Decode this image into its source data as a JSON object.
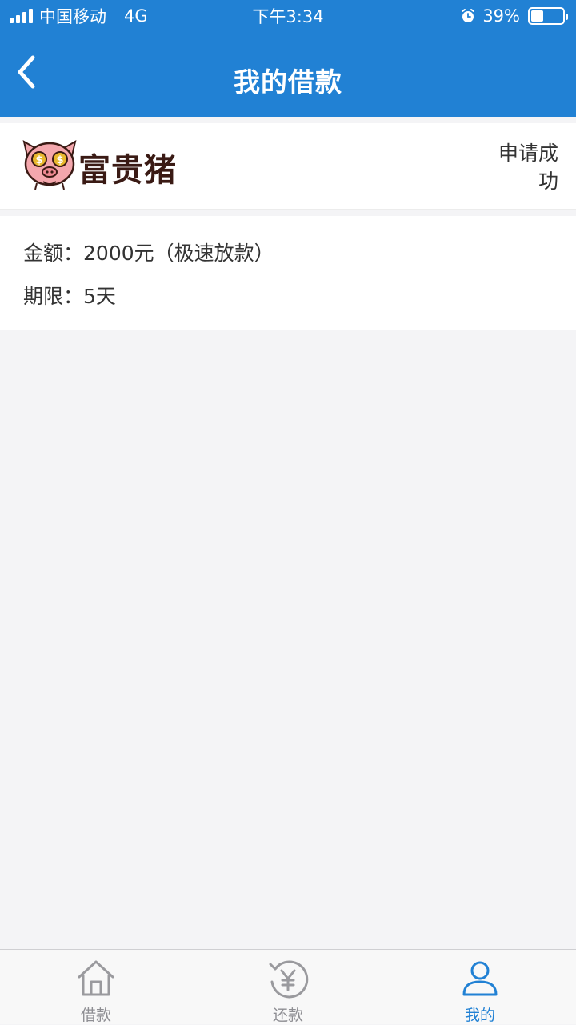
{
  "status_bar": {
    "carrier": "中国移动",
    "network": "4G",
    "time": "下午3:34",
    "battery_percent": "39%",
    "battery_level": 0.39,
    "icons": [
      "signal-icon",
      "alarm-icon",
      "battery-icon"
    ]
  },
  "nav": {
    "title": "我的借款",
    "back_icon": "chevron-left-icon"
  },
  "loan": {
    "lender_name": "富贵猪",
    "status": "申请成功",
    "amount_label": "金额：",
    "amount_value": "2000元（极速放款）",
    "term_label": "期限：",
    "term_value": "5天"
  },
  "tabs": [
    {
      "label": "借款",
      "icon": "home-icon",
      "active": false
    },
    {
      "label": "还款",
      "icon": "repay-yen-icon",
      "active": false
    },
    {
      "label": "我的",
      "icon": "user-icon",
      "active": true
    }
  ],
  "colors": {
    "primary": "#2181d4",
    "background": "#f4f4f6",
    "tab_inactive": "#8e8e93",
    "lender_name": "#3a1a14",
    "pig_pink": "#f4a7ad",
    "coin_gold": "#e8b82e"
  }
}
